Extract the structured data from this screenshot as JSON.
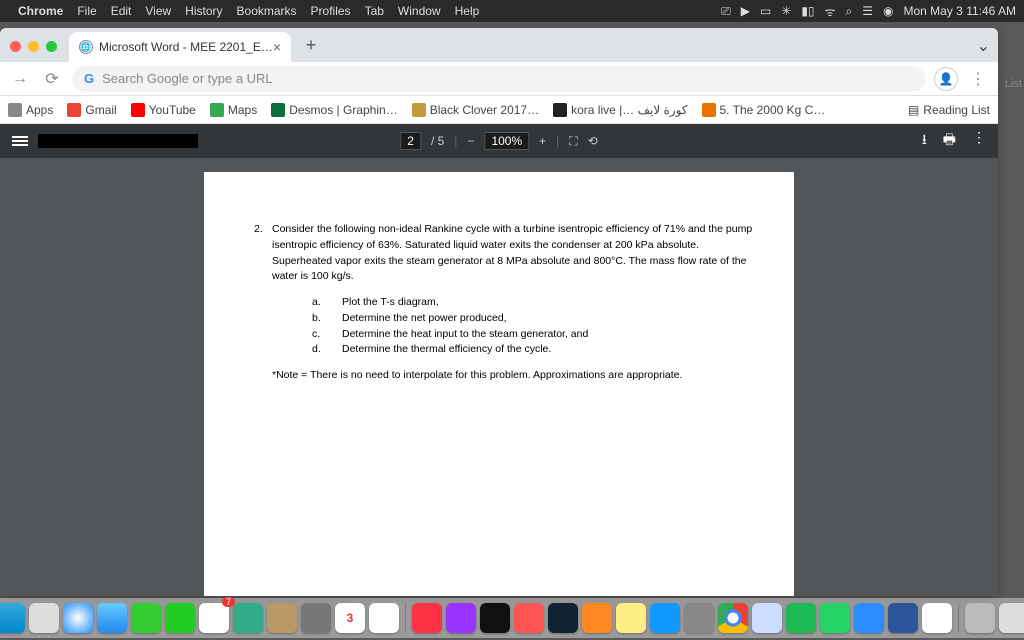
{
  "mac_menu": {
    "app": "Chrome",
    "items": [
      "File",
      "Edit",
      "View",
      "History",
      "Bookmarks",
      "Profiles",
      "Tab",
      "Window",
      "Help"
    ],
    "clock": "Mon May 3  11:46 AM"
  },
  "chrome": {
    "tab_title": "Microsoft Word - MEE 2201_E…",
    "omnibox_placeholder": "Search Google or type a URL",
    "bookmarks": {
      "apps": "Apps",
      "items": [
        "Gmail",
        "YouTube",
        "Maps",
        "Desmos | Graphin…",
        "Black Clover 2017…",
        "kora live |… كورة لايف",
        "5. The 2000 Kg C…"
      ],
      "reading_list": "Reading List"
    }
  },
  "right_hint": "List",
  "pdf": {
    "page_current": "2",
    "page_total": "5",
    "zoom": "100%",
    "problem_number": "2.",
    "problem_text": "Consider the following non-ideal Rankine cycle with a turbine isentropic efficiency of 71% and the pump isentropic efficiency of 63%. Saturated liquid water exits the condenser at 200 kPa absolute. Superheated vapor exits the steam generator at 8 MPa absolute and 800°C. The mass flow rate of the water is 100 kg/s.",
    "subs": {
      "a": {
        "lbl": "a.",
        "txt": "Plot the T-s diagram,"
      },
      "b": {
        "lbl": "b.",
        "txt": "Determine the net power produced,"
      },
      "c": {
        "lbl": "c.",
        "txt": "Determine the heat input to the steam generator, and"
      },
      "d": {
        "lbl": "d.",
        "txt": "Determine the thermal efficiency of the cycle."
      }
    },
    "note": "*Note = There is no need to interpolate for this problem. Approximations are appropriate."
  },
  "dock_badge": "3"
}
